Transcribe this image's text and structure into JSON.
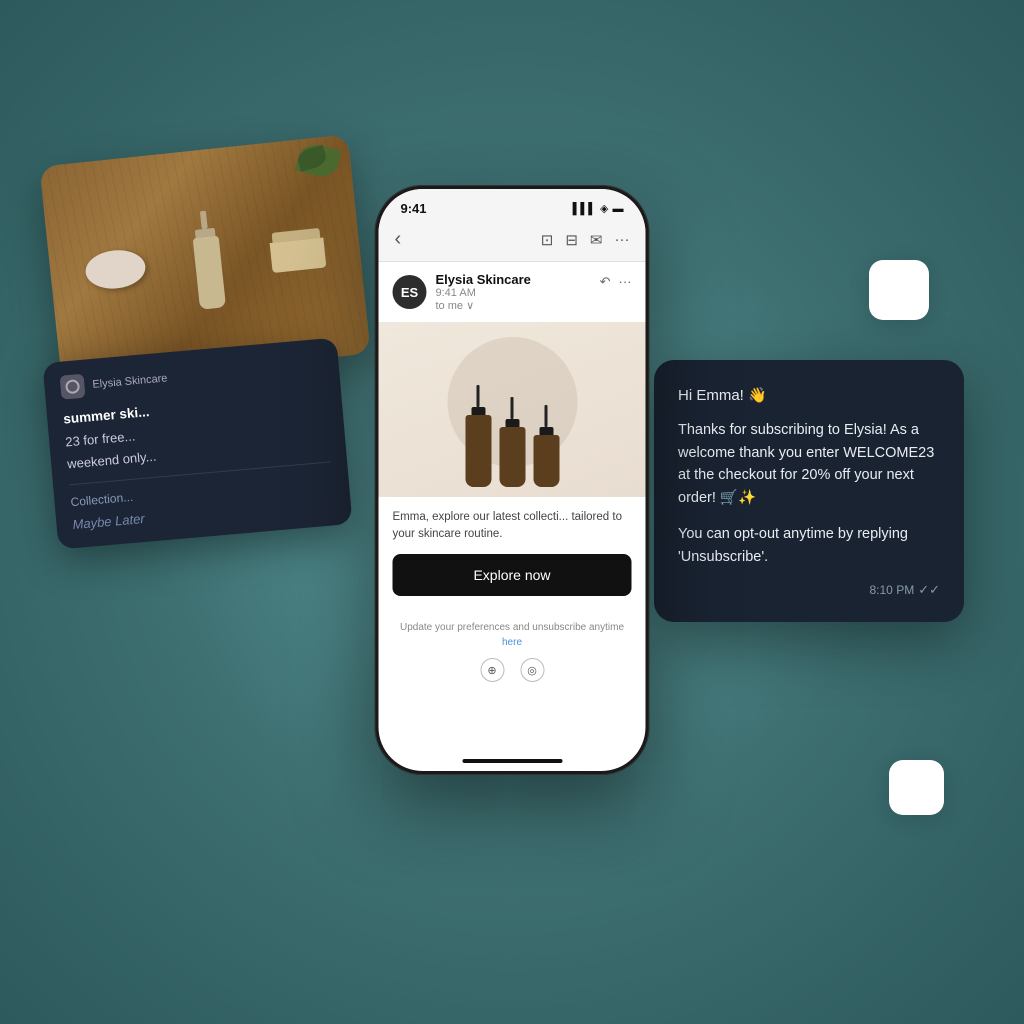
{
  "background": {
    "color": "#4a8a8c"
  },
  "phone": {
    "status_bar": {
      "time": "9:41",
      "signal": "▌▌▌",
      "wifi": "WiFi",
      "battery": "🔋"
    },
    "email_header": {
      "back": "‹",
      "icons": [
        "⊡",
        "⊟",
        "✉",
        "···"
      ]
    },
    "sender": {
      "name": "Elysia Skincare",
      "time": "9:41 AM",
      "to": "to me ∨",
      "avatar_text": "ES",
      "reply_icon": "↶",
      "more_icon": "···"
    },
    "email_body": {
      "description": "Emma, explore our latest collecti... tailored to your skincare routine."
    },
    "cta_button": "Explore now",
    "footer": {
      "text": "Update your preferences and unsubscribe anytime",
      "link_text": "here"
    }
  },
  "sms_card": {
    "greeting": "Hi Emma! 👋",
    "line1": "",
    "body": "Thanks for subscribing to Elysia! As a welcome thank you enter WELCOME23 at the checkout for 20% off your next order! 🛒✨",
    "line2": "",
    "opt_out": "You can opt-out anytime by replying 'Unsubscribe'.",
    "time": "8:10 PM",
    "checkmarks": "✓✓"
  },
  "push_card": {
    "text1": "summer ski...",
    "text2": "23 for free...",
    "text3": "weekend only...",
    "collection": "Collection...",
    "later": "Maybe Later"
  }
}
